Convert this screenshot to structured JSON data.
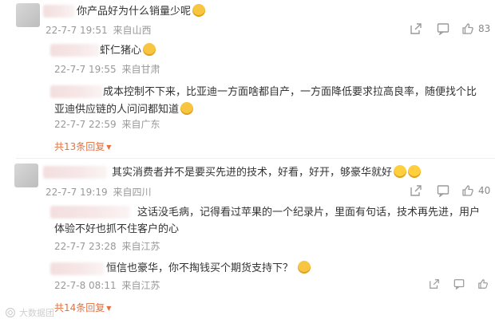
{
  "comments": [
    {
      "text": "你产品好为什么销量少呢",
      "time": "22-7-7 19:51",
      "from": "来自山西",
      "likes": "83",
      "replies": [
        {
          "text": "虾仁猪心",
          "time": "22-7-7 19:55",
          "from": "来自甘肃"
        },
        {
          "text": "成本控制不下来，比亚迪一方面啥都自产，一方面降低要求拉高良率，随便找个比亚迪供应链的人问问都知道",
          "time": "22-7-7 22:59",
          "from": "来自广东"
        }
      ],
      "more": "共13条回复"
    },
    {
      "text": "其实消费者并不是要买先进的技术，好看，好开，够豪华就好",
      "time": "22-7-7 19:19",
      "from": "来自四川",
      "likes": "40",
      "replies": [
        {
          "text": "这话没毛病，记得看过苹果的一个纪录片，里面有句话，技术再先进，用户体验不好也抓不住客户的心",
          "time": "22-7-7 23:28",
          "from": "来自江苏"
        },
        {
          "text": "恒信也豪华，你不掏钱买个期货支持下？",
          "time": "22-7-8 08:11",
          "from": "来自江苏"
        }
      ],
      "more": "共14条回复"
    }
  ],
  "watermark": "大数据团",
  "icons": {
    "share": "share-icon",
    "comment": "comment-icon",
    "like": "like-icon"
  },
  "colors": {
    "accent": "#e8703c",
    "meta": "#999999",
    "text": "#333333"
  }
}
